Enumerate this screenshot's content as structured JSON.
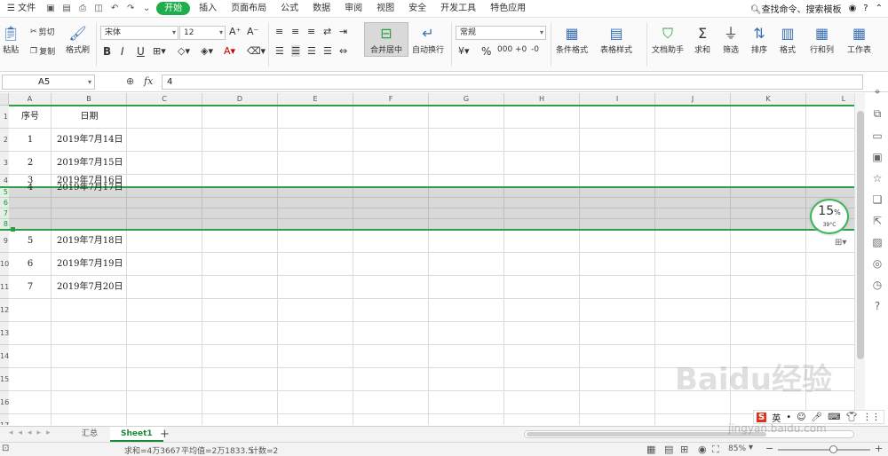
{
  "menubar": {
    "file": "文件",
    "tabs": [
      "开始",
      "插入",
      "页面布局",
      "公式",
      "数据",
      "审阅",
      "视图",
      "安全",
      "开发工具",
      "特色应用"
    ],
    "active_tab": "开始",
    "search": "查找命令、搜索模板"
  },
  "ribbon": {
    "paste": "粘贴",
    "cut": "剪切",
    "copy": "复制",
    "format_painter": "格式刷",
    "font_name": "宋体",
    "font_size": "12",
    "merge_center": "合并居中",
    "wrap_text": "自动换行",
    "number_format": "常规",
    "percent": "%",
    "cond_format": "条件格式",
    "table_style": "表格样式",
    "doc_assistant": "文档助手",
    "sum": "求和",
    "filter": "筛选",
    "sort": "排序",
    "format": "格式",
    "row_col": "行和列",
    "worksheet": "工作表"
  },
  "formula_bar": {
    "name_box": "A5",
    "fx": "fx",
    "content": "4"
  },
  "sheet": {
    "columns": [
      "A",
      "B",
      "C",
      "D",
      "E",
      "F",
      "G",
      "H",
      "I",
      "J",
      "K",
      "L"
    ],
    "rows": [
      "1",
      "2",
      "3",
      "4",
      "5",
      "6",
      "7",
      "8",
      "9",
      "10",
      "11",
      "12",
      "13",
      "14",
      "15",
      "16",
      "17"
    ],
    "header": {
      "a": "序号",
      "b": "日期"
    },
    "data": [
      {
        "a": "1",
        "b": "2019年7月14日"
      },
      {
        "a": "2",
        "b": "2019年7月15日"
      },
      {
        "a": "3",
        "b": "2019年7月16日"
      },
      {
        "a": "4",
        "b": "2019年7月17日"
      },
      {
        "a": "5",
        "b": "2019年7月18日"
      },
      {
        "a": "6",
        "b": "2019年7月19日"
      },
      {
        "a": "7",
        "b": "2019年7月20日"
      }
    ]
  },
  "widget": {
    "percent": "15",
    "unit": "%",
    "temp": "39°C"
  },
  "sheet_tabs": {
    "tab1": "汇总",
    "tab2": "Sheet1",
    "add": "+"
  },
  "status": {
    "sum": "求和=4万3667",
    "avg": "平均值=2万1833.5",
    "count": "计数=2",
    "zoom": "85%"
  },
  "watermark": {
    "brand": "Baidu经验",
    "url": "jingyan.baidu.com"
  }
}
